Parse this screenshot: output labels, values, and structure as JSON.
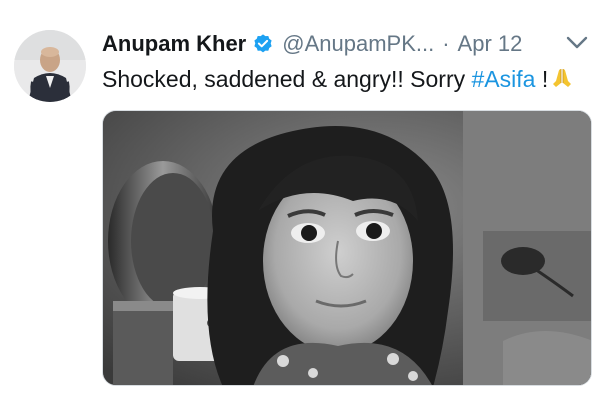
{
  "tweet": {
    "author": {
      "display_name": "Anupam Kher",
      "handle": "@AnupamPK...",
      "verified": true
    },
    "separator": "·",
    "date": "Apr 12",
    "text": {
      "prefix": "Shocked, saddened & angry!! Sorry ",
      "hashtag": "#Asifa",
      "suffix": " !",
      "emoji": "folded-hands-emoji"
    },
    "media": {
      "type": "photo",
      "tone": "black-and-white"
    }
  },
  "colors": {
    "text": "#14171a",
    "secondary": "#657786",
    "link": "#1b95e0",
    "verified": "#1da1f2"
  },
  "icons": {
    "verified": "verified-badge-icon",
    "menu": "chevron-down-icon"
  }
}
